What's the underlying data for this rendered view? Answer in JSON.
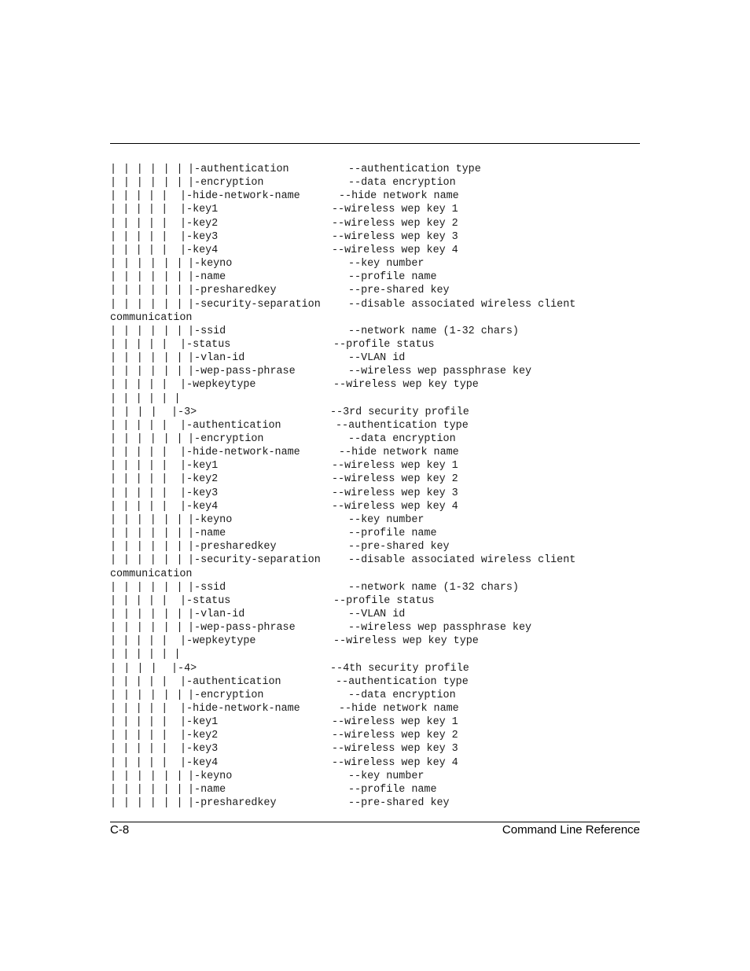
{
  "page": {
    "footer_left": "C-8",
    "footer_right": "Command Line Reference"
  },
  "lines": [
    {
      "indent": 7,
      "style": "a",
      "name": "|-authentication",
      "desc": "--authentication type"
    },
    {
      "indent": 7,
      "style": "a",
      "name": "|-encryption",
      "desc": "--data encryption"
    },
    {
      "indent": 6,
      "style": "h",
      "name": "|-hide-network-name",
      "desc": "--hide network name"
    },
    {
      "indent": 6,
      "style": "b",
      "name": "|-key1",
      "desc": "--wireless wep key 1"
    },
    {
      "indent": 6,
      "style": "b",
      "name": "|-key2",
      "desc": "--wireless wep key 2"
    },
    {
      "indent": 6,
      "style": "b",
      "name": "|-key3",
      "desc": "--wireless wep key 3"
    },
    {
      "indent": 6,
      "style": "b",
      "name": "|-key4",
      "desc": "--wireless wep key 4"
    },
    {
      "indent": 7,
      "style": "a",
      "name": "|-keyno",
      "desc": "--key number"
    },
    {
      "indent": 7,
      "style": "a",
      "name": "|-name",
      "desc": "--profile name"
    },
    {
      "indent": 7,
      "style": "a",
      "name": "|-presharedkey",
      "desc": "--pre-shared key"
    },
    {
      "indent": 7,
      "style": "a",
      "name": "|-security-separation",
      "desc": "--disable associated wireless client"
    },
    {
      "indent": 0,
      "style": "wrap",
      "name": "communication",
      "desc": ""
    },
    {
      "indent": 7,
      "style": "a",
      "name": "|-ssid",
      "desc": "--network name (1-32 chars)"
    },
    {
      "indent": 6,
      "style": "s",
      "name": "|-status",
      "desc": "--profile status"
    },
    {
      "indent": 7,
      "style": "a",
      "name": "|-vlan-id",
      "desc": "--VLAN id"
    },
    {
      "indent": 7,
      "style": "a",
      "name": "|-wep-pass-phrase",
      "desc": "--wireless wep passphrase key"
    },
    {
      "indent": 6,
      "style": "s",
      "name": "|-wepkeytype",
      "desc": "--wireless wep key type"
    },
    {
      "indent": 6,
      "style": "blank",
      "name": "",
      "desc": ""
    },
    {
      "indent": 5,
      "style": "p",
      "name": "|-3>",
      "desc": "--3rd security profile"
    },
    {
      "indent": 6,
      "style": "c",
      "name": "|-authentication",
      "desc": "--authentication type"
    },
    {
      "indent": 7,
      "style": "a",
      "name": "|-encryption",
      "desc": "--data encryption"
    },
    {
      "indent": 6,
      "style": "h",
      "name": "|-hide-network-name",
      "desc": "--hide network name"
    },
    {
      "indent": 6,
      "style": "b",
      "name": "|-key1",
      "desc": "--wireless wep key 1"
    },
    {
      "indent": 6,
      "style": "b",
      "name": "|-key2",
      "desc": "--wireless wep key 2"
    },
    {
      "indent": 6,
      "style": "b",
      "name": "|-key3",
      "desc": "--wireless wep key 3"
    },
    {
      "indent": 6,
      "style": "b",
      "name": "|-key4",
      "desc": "--wireless wep key 4"
    },
    {
      "indent": 7,
      "style": "a",
      "name": "|-keyno",
      "desc": "--key number"
    },
    {
      "indent": 7,
      "style": "a",
      "name": "|-name",
      "desc": "--profile name"
    },
    {
      "indent": 7,
      "style": "a",
      "name": "|-presharedkey",
      "desc": "--pre-shared key"
    },
    {
      "indent": 7,
      "style": "a",
      "name": "|-security-separation",
      "desc": "--disable associated wireless client"
    },
    {
      "indent": 0,
      "style": "wrap",
      "name": "communication",
      "desc": ""
    },
    {
      "indent": 7,
      "style": "a",
      "name": "|-ssid",
      "desc": "--network name (1-32 chars)"
    },
    {
      "indent": 6,
      "style": "s",
      "name": "|-status",
      "desc": "--profile status"
    },
    {
      "indent": 7,
      "style": "a",
      "name": "|-vlan-id",
      "desc": "--VLAN id"
    },
    {
      "indent": 7,
      "style": "a",
      "name": "|-wep-pass-phrase",
      "desc": "--wireless wep passphrase key"
    },
    {
      "indent": 6,
      "style": "s",
      "name": "|-wepkeytype",
      "desc": "--wireless wep key type"
    },
    {
      "indent": 6,
      "style": "blank",
      "name": "",
      "desc": ""
    },
    {
      "indent": 5,
      "style": "p",
      "name": "|-4>",
      "desc": "--4th security profile"
    },
    {
      "indent": 6,
      "style": "c",
      "name": "|-authentication",
      "desc": "--authentication type"
    },
    {
      "indent": 7,
      "style": "a",
      "name": "|-encryption",
      "desc": "--data encryption"
    },
    {
      "indent": 6,
      "style": "h",
      "name": "|-hide-network-name",
      "desc": "--hide network name"
    },
    {
      "indent": 6,
      "style": "b",
      "name": "|-key1",
      "desc": "--wireless wep key 1"
    },
    {
      "indent": 6,
      "style": "b",
      "name": "|-key2",
      "desc": "--wireless wep key 2"
    },
    {
      "indent": 6,
      "style": "b",
      "name": "|-key3",
      "desc": "--wireless wep key 3"
    },
    {
      "indent": 6,
      "style": "b",
      "name": "|-key4",
      "desc": "--wireless wep key 4"
    },
    {
      "indent": 7,
      "style": "a",
      "name": "|-keyno",
      "desc": "--key number"
    },
    {
      "indent": 7,
      "style": "a",
      "name": "|-name",
      "desc": "--profile name"
    },
    {
      "indent": 7,
      "style": "a",
      "name": "|-presharedkey",
      "desc": "--pre-shared key"
    }
  ]
}
